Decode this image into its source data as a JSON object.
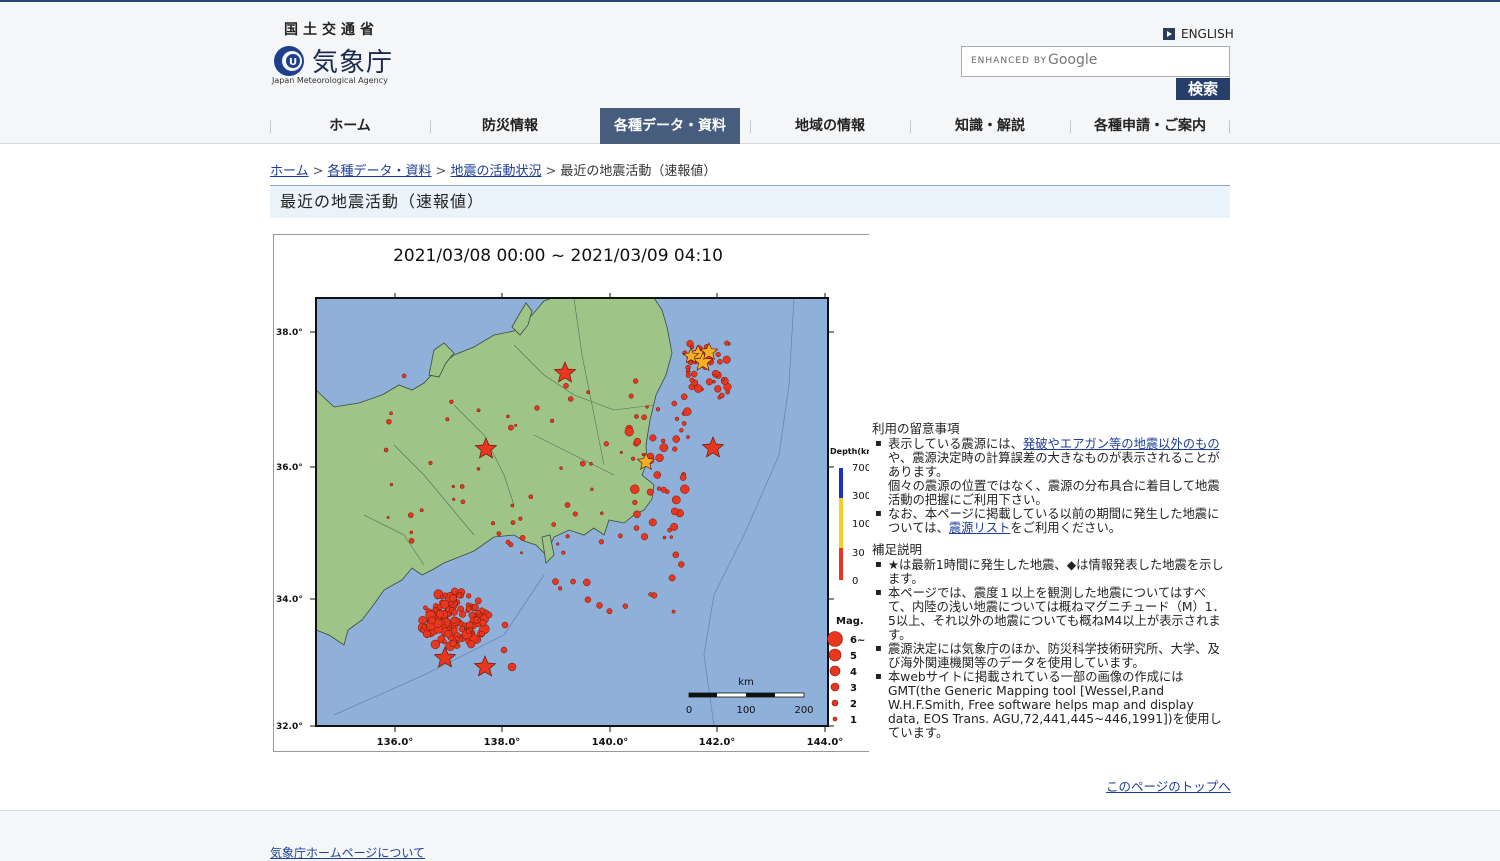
{
  "header": {
    "org_top": "国土交通省",
    "org_name": "気象庁",
    "org_en": "Japan Meteorological Agency",
    "english_link": "ENGLISH",
    "search_brand_prefix": "ENHANCED BY",
    "search_brand": "Google",
    "search_button": "検索"
  },
  "nav": [
    {
      "label": "ホーム"
    },
    {
      "label": "防災情報"
    },
    {
      "label": "各種データ・資料",
      "active": true
    },
    {
      "label": "地域の情報"
    },
    {
      "label": "知識・解説"
    },
    {
      "label": "各種申請・ご案内"
    }
  ],
  "breadcrumb": {
    "items": [
      "ホーム",
      "各種データ・資料",
      "地震の活動状況"
    ],
    "current": "最近の地震活動（速報値）",
    "separator": ">"
  },
  "page_title": "最近の地震活動（速報値）",
  "map": {
    "title": "2021/03/08 00:00 ~ 2021/03/09 04:10",
    "lon_labels": [
      "136.0°",
      "138.0°",
      "140.0°",
      "142.0°",
      "144.0°"
    ],
    "lat_labels": [
      "38.0°",
      "36.0°",
      "34.0°",
      "32.0°"
    ],
    "depth_title": "Depth(km",
    "depth_labels": [
      "700",
      "300",
      "100",
      "30",
      "0"
    ],
    "mag_title": "Mag.",
    "mag_labels": [
      "6~",
      "5",
      "4",
      "3",
      "2",
      "1"
    ],
    "scale_unit": "km",
    "scale_labels": [
      "0",
      "100",
      "200"
    ],
    "colors": {
      "sea": "#8fb0d8",
      "land": "#9fc488",
      "quake": "#e8371e",
      "star": "#e8371e",
      "star_recent": "#f4b223"
    }
  },
  "notes": {
    "usage_title": "利用の留意事項",
    "usage_1a": "表示している震源には、",
    "usage_1_link": "発破やエアガン等の地震以外のもの",
    "usage_1b": "や、震源決定時の計算誤差の大きなものが表示されることがあります。",
    "usage_1c": "個々の震源の位置ではなく、震源の分布具合に着目して地震活動の把握にご利用下さい。",
    "usage_2a": "なお、本ページに掲載している以前の期間に発生した地震については、",
    "usage_2_link": "震源リスト",
    "usage_2b": "をご利用ください。",
    "supp_title": "補足説明",
    "supp_1": "★は最新1時間に発生した地震、◆は情報発表した地震を示します。",
    "supp_2": "本ページでは、震度１以上を観測した地震についてはすべて、内陸の浅い地震については概ねマグニチュード（M）1．5以上、それ以外の地震についても概ねM4以上が表示されます。",
    "supp_3": "震源決定には気象庁のほか、防災科学技術研究所、大学、及び海外関連機関等のデータを使用しています。",
    "supp_4": "本webサイトに掲載されている一部の画像の作成にはGMT(the Generic Mapping tool [Wessel,P.and W.H.F.Smith, Free software helps map and display data, EOS Trans. AGU,72,441,445~446,1991])を使用しています。"
  },
  "page_top_link": "このページのトップへ",
  "footer_link": "気象庁ホームページについて"
}
